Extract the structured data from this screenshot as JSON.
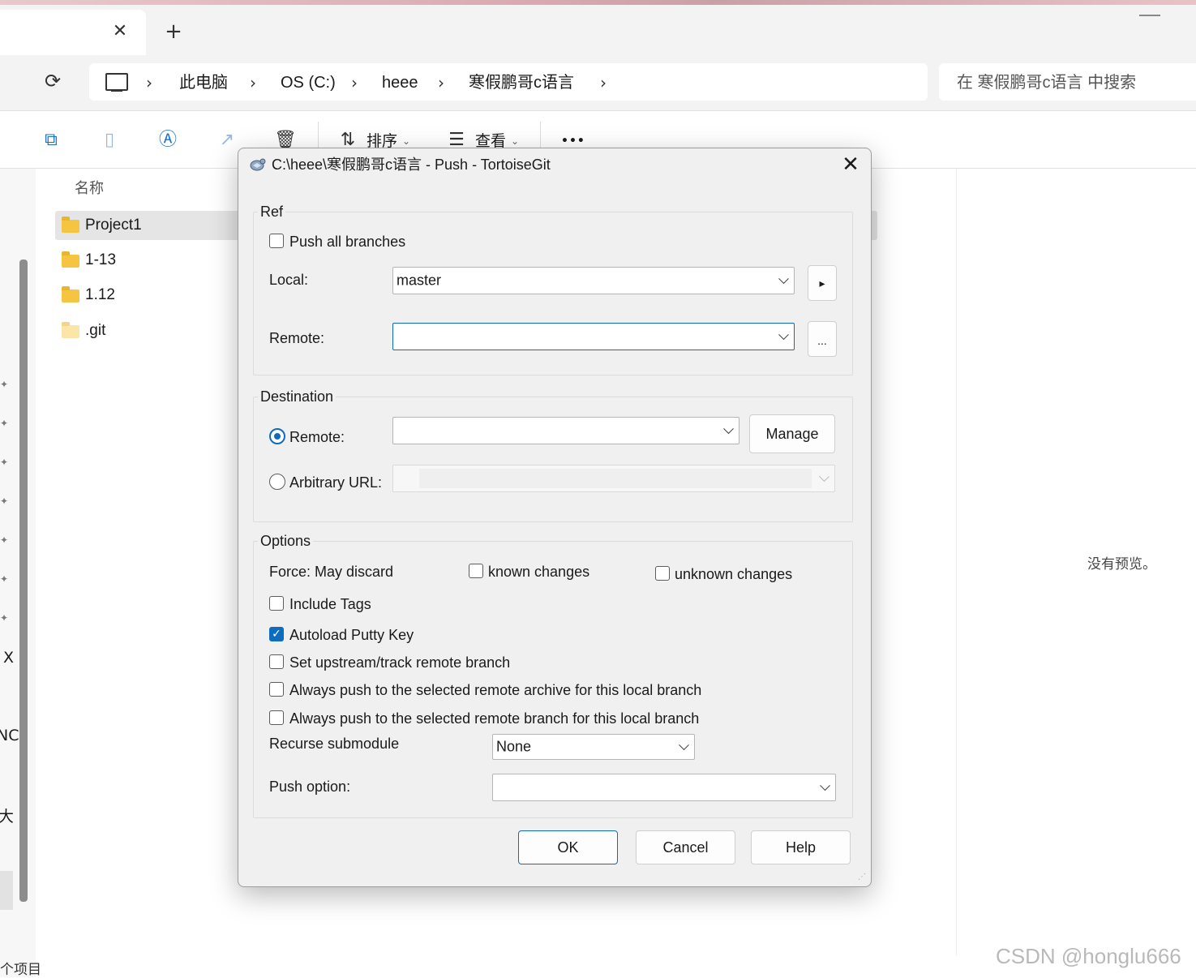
{
  "explorer": {
    "tab_close": "✕",
    "tab_add": "+",
    "breadcrumbs": [
      "此电脑",
      "OS (C:)",
      "heee",
      "寒假鹏哥c语言"
    ],
    "chevron": "›",
    "search_placeholder": "在 寒假鹏哥c语言 中搜索",
    "toolbar": {
      "sort_label": "排序",
      "view_label": "查看",
      "more_label": "•••"
    },
    "column_name": "名称",
    "files": [
      {
        "name": "Project1",
        "type": "folder"
      },
      {
        "name": "1-13",
        "type": "folder"
      },
      {
        "name": "1.12",
        "type": "folder"
      },
      {
        "name": ".git",
        "type": "folder-hidden"
      }
    ],
    "nav_fragments": [
      "X",
      "NC",
      "大",
      "个项目"
    ],
    "no_preview": "没有预览。",
    "watermark": "CSDN @honglu666"
  },
  "dialog": {
    "title": "C:\\heee\\寒假鹏哥c语言 - Push - TortoiseGit",
    "close_label": "✕",
    "ref": {
      "group_label": "Ref",
      "push_all_branches": {
        "label": "Push all branches",
        "checked": false
      },
      "local_label": "Local:",
      "local_value": "master",
      "local_side_button": "▸",
      "remote_label": "Remote:",
      "remote_value": "",
      "remote_side_button": "..."
    },
    "destination": {
      "group_label": "Destination",
      "remote_radio_label": "Remote:",
      "remote_selected": true,
      "remote_value": "",
      "manage_button": "Manage",
      "arbitrary_url_label": "Arbitrary URL:",
      "arbitrary_url_value": ""
    },
    "options": {
      "group_label": "Options",
      "force_label": "Force: May discard",
      "known_changes": {
        "label": "known changes",
        "checked": false
      },
      "unknown_changes": {
        "label": "unknown changes",
        "checked": false
      },
      "include_tags": {
        "label": "Include Tags",
        "checked": false
      },
      "autoload_putty": {
        "label": "Autoload Putty Key",
        "checked": true
      },
      "set_upstream": {
        "label": "Set upstream/track remote branch",
        "checked": false
      },
      "always_push_archive": {
        "label": "Always push to the selected remote archive for this local branch",
        "checked": false
      },
      "always_push_branch": {
        "label": "Always push to the selected remote branch for this local branch",
        "checked": false
      },
      "recurse_label": "Recurse submodule",
      "recurse_value": "None",
      "push_option_label": "Push option:",
      "push_option_value": ""
    },
    "buttons": {
      "ok": "OK",
      "cancel": "Cancel",
      "help": "Help"
    }
  },
  "colors": {
    "accent": "#0f6cbd",
    "dialog_bg": "#f0f0f0",
    "folder": "#f5c542"
  }
}
